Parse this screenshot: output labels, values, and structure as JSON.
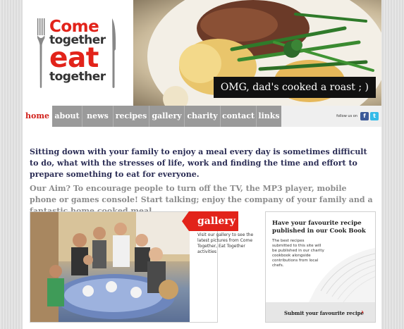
{
  "logo": {
    "line1": "Come",
    "line2": "together",
    "line3": "eat",
    "line4": "together"
  },
  "hero": {
    "caption": "OMG, dad's cooked a roast ; )"
  },
  "nav": {
    "items": [
      {
        "label": "home",
        "active": true
      },
      {
        "label": "about",
        "active": false
      },
      {
        "label": "news",
        "active": false
      },
      {
        "label": "recipes",
        "active": false
      },
      {
        "label": "gallery",
        "active": false
      },
      {
        "label": "charity",
        "active": false
      },
      {
        "label": "contact",
        "active": false
      },
      {
        "label": "links",
        "active": false
      }
    ],
    "follow_text": "follow us on",
    "social": [
      "facebook-icon",
      "twitter-icon"
    ]
  },
  "intro": {
    "text": "Sitting down with your family to enjoy a meal every day is sometimes difficult to do, what with the stresses of life, work and finding the time and effort to prepare something to eat for everyone.",
    "aim": "Our Aim? To encourage people to turn off the TV, the MP3 player, mobile phone or games console! Start talking; enjoy the company of your family and a fantastic home cooked meal...."
  },
  "gallery": {
    "title": "gallery",
    "description": "Visit our gallery to see the latest pictures from Come Together, Eat Together activities"
  },
  "cookbook": {
    "title": "Have your favourite recipe published in our Cook Book",
    "text": "The best recipes submitted to this site will be published in our charity cookbook alongside contributions from local chefs.",
    "link": "Submit your favourite recipe",
    "arrow": "›"
  },
  "colors": {
    "accent_red": "#e2231a",
    "nav_grey": "#9a9a9a",
    "intro_navy": "#2b2d55",
    "aim_grey": "#8c8c8c",
    "facebook": "#3b5998",
    "twitter": "#35bbe8"
  }
}
